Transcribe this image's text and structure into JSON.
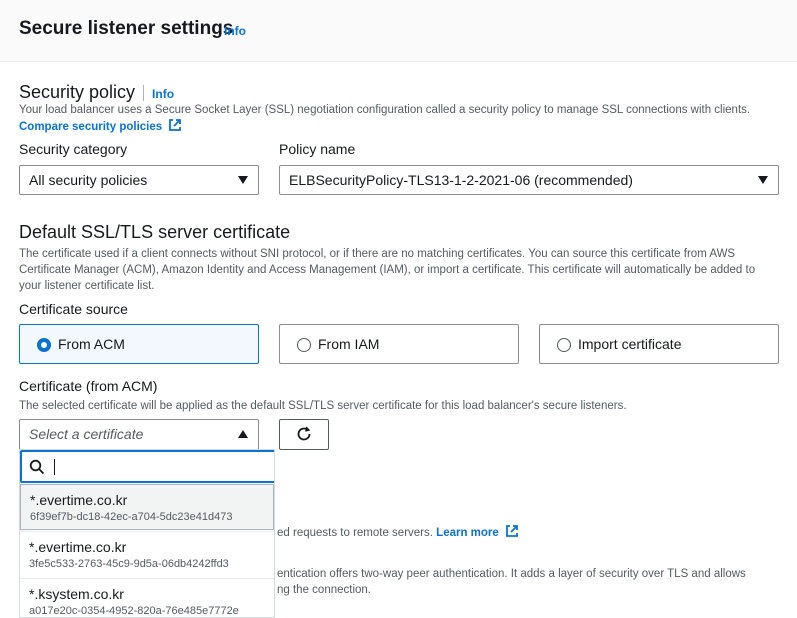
{
  "header": {
    "title": "Secure listener settings",
    "info": "Info"
  },
  "security_policy": {
    "heading": "Security policy",
    "info": "Info",
    "description": "Your load balancer uses a Secure Socket Layer (SSL) negotiation configuration called a security policy to manage SSL connections with clients.",
    "compare_link": "Compare security policies",
    "category_label": "Security category",
    "category_value": "All security policies",
    "policy_label": "Policy name",
    "policy_value": "ELBSecurityPolicy-TLS13-1-2-2021-06 (recommended)"
  },
  "default_cert": {
    "heading": "Default SSL/TLS server certificate",
    "description": "The certificate used if a client connects without SNI protocol, or if there are no matching certificates. You can source this certificate from AWS Certificate Manager (ACM), Amazon Identity and Access Management (IAM), or import a certificate. This certificate will automatically be added to your listener certificate list.",
    "source_label": "Certificate source",
    "sources": [
      "From ACM",
      "From IAM",
      "Import certificate"
    ],
    "selected_source_index": 0,
    "cert_label": "Certificate (from ACM)",
    "cert_description": "The selected certificate will be applied as the default SSL/TLS server certificate for this load balancer's secure listeners.",
    "cert_placeholder": "Select a certificate",
    "search_value": ""
  },
  "options": [
    {
      "name": "*.evertime.co.kr",
      "id": "6f39ef7b-dc18-42ec-a704-5dc23e41d473"
    },
    {
      "name": "*.evertime.co.kr",
      "id": "3fe5c533-2763-45c9-9d5a-06db4242ffd3"
    },
    {
      "name": "*.ksystem.co.kr",
      "id": "a017e20c-0354-4952-820a-76e485e7772e"
    }
  ],
  "hidden_text": {
    "line1": "ed requests to remote servers.",
    "learn_more": "Learn more",
    "line2a": "entication offers two-way peer authentication. It adds a layer of security over TLS and allows",
    "line2b": "ng the connection."
  },
  "colors": {
    "accent": "#0972d3",
    "text": "#16191f",
    "muted": "#545b64"
  }
}
